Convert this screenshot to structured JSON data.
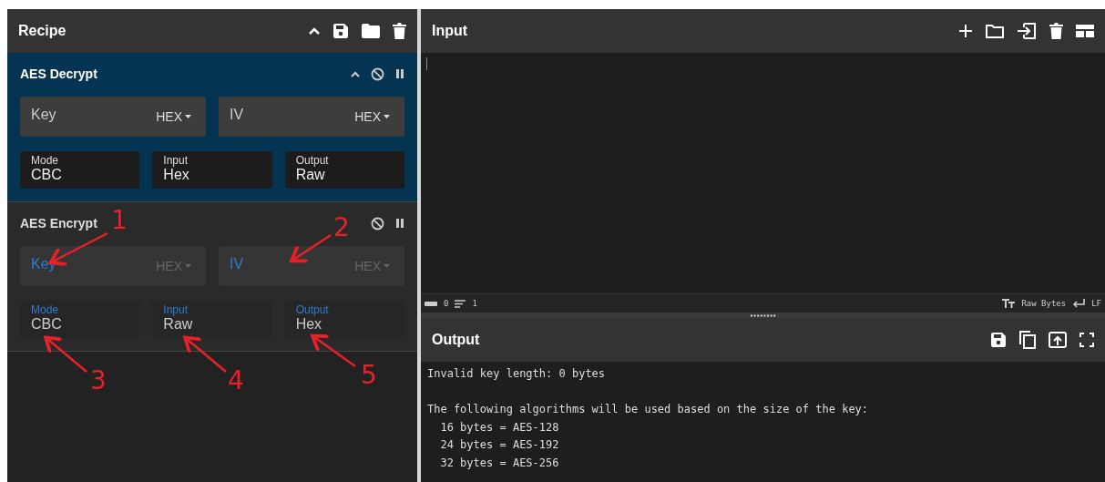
{
  "recipe": {
    "title": "Recipe",
    "operations": [
      {
        "name": "AES Decrypt",
        "highlighted": true,
        "show_collapse": true,
        "labels_accented": false,
        "inputs": [
          {
            "label": "Key",
            "format": "HEX"
          },
          {
            "label": "IV",
            "format": "HEX"
          }
        ],
        "options": [
          {
            "label": "Mode",
            "value": "CBC"
          },
          {
            "label": "Input",
            "value": "Hex"
          },
          {
            "label": "Output",
            "value": "Raw"
          }
        ]
      },
      {
        "name": "AES Encrypt",
        "highlighted": false,
        "show_collapse": false,
        "labels_accented": true,
        "inputs": [
          {
            "label": "Key",
            "format": "HEX"
          },
          {
            "label": "IV",
            "format": "HEX"
          }
        ],
        "options": [
          {
            "label": "Mode",
            "value": "CBC"
          },
          {
            "label": "Input",
            "value": "Raw"
          },
          {
            "label": "Output",
            "value": "Hex"
          }
        ]
      }
    ]
  },
  "input": {
    "title": "Input"
  },
  "status_bar": {
    "length": "0",
    "lines": "1",
    "encoding": "Raw Bytes",
    "eol": "LF"
  },
  "output": {
    "title": "Output",
    "paragraphs": [
      [
        "Invalid key length: 0 bytes"
      ],
      [
        "The following algorithms will be used based on the size of the key:",
        "  16 bytes = AES-128",
        "  24 bytes = AES-192",
        "  32 bytes = AES-256"
      ]
    ]
  },
  "annotations": [
    "1",
    "2",
    "3",
    "4",
    "5"
  ]
}
